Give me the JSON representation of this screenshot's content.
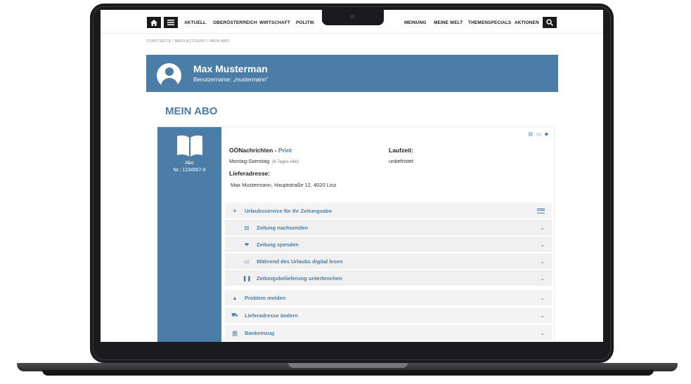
{
  "nav": {
    "home_icon": "home-icon",
    "menu_icon": "menu-icon",
    "links_left": [
      "AKTUELL",
      "OBERÖSTERREICH",
      "WIRTSCHAFT",
      "POLITIK"
    ],
    "links_right": [
      "MEINUNG",
      "MEINE WELT",
      "THEMENSPECIALS",
      "AKTIONEN"
    ],
    "search_icon": "search-icon"
  },
  "breadcrumb": "STARTSEITE / MEIN ACCOUNT / MEIN ABO",
  "profile": {
    "name": "Max Musterman",
    "username": "Benutzername: „mustermann“"
  },
  "page_title": "MEIN ABO",
  "subscription": {
    "type_label": "Abo",
    "number": "Nr.: 1234567-8",
    "product_name": "OÖNachrichten - ",
    "product_variant": "Print",
    "days": "Montag-Samstag",
    "days_note": "(6-Tages-Abo)",
    "laufzeit_label": "Laufzeit:",
    "laufzeit_value": "unbefristet",
    "address_label": "Lieferadresse:",
    "address_value": "Max Mustermann, Hauptstraße 12, 4020 Linz"
  },
  "actions": {
    "urlaub": "Urlaubsservice für Ihr Zeitungsabo",
    "urlaub_items": [
      "Zeitung nachsenden",
      "Zeitung spenden",
      "Während des Urlaubs digital lesen",
      "Zeitungsbelieferung unterbrechen"
    ],
    "problem": "Problem melden",
    "address_change": "Lieferadresse ändern",
    "bank": "Bankeinzug"
  },
  "colors": {
    "brand_blue": "#4b7da7",
    "bezel": "#1b1b1d"
  }
}
